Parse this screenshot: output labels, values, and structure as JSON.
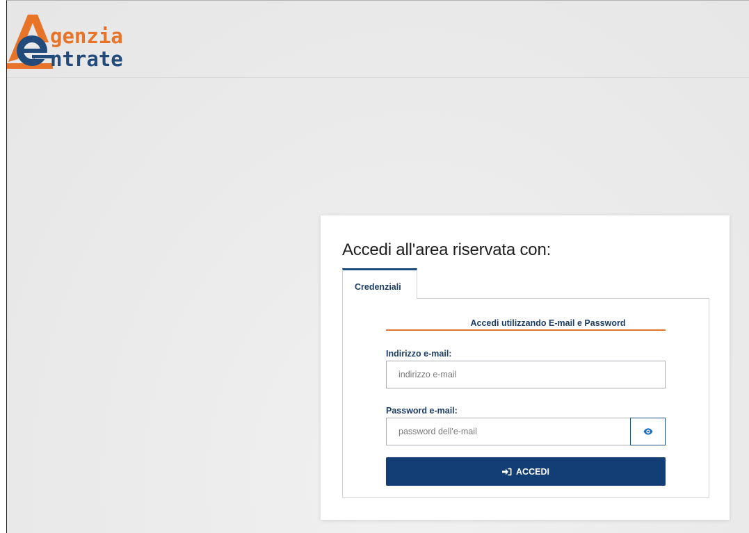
{
  "brand": {
    "line1": "genzia",
    "line2": "ntrate",
    "orange": "#e8742a",
    "blue": "#224b7c"
  },
  "login": {
    "title": "Accedi all'area riservata con:",
    "tab_label": "Credenziali",
    "form_heading": "Accedi utilizzando E-mail e Password",
    "email_label": "Indirizzo e-mail:",
    "email_placeholder": "indirizzo e-mail",
    "email_value": "",
    "password_label": "Password e-mail:",
    "password_placeholder": "password dell'e-mail",
    "password_value": "",
    "show_password_icon": "eye-icon",
    "submit_icon": "sign-in-icon",
    "submit_label": "ACCEDI"
  },
  "colors": {
    "primary": "#123e75",
    "accent": "#e2742b",
    "label": "#1c3d66"
  }
}
